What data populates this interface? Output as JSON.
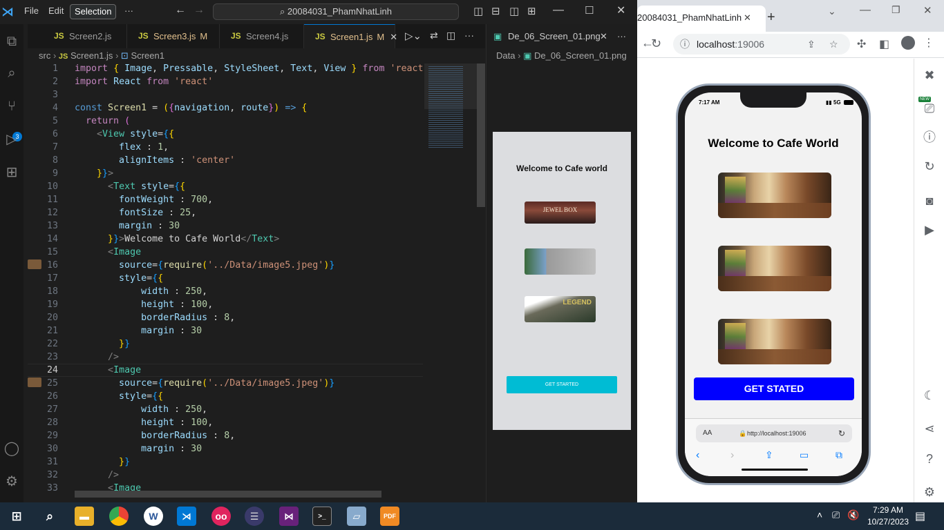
{
  "vscode": {
    "menu": [
      "File",
      "Edit",
      "Selection"
    ],
    "more": "···",
    "command_center": "20084031_PhamNhatLinh",
    "tabs": [
      {
        "label": "Screen2.js",
        "modified": ""
      },
      {
        "label": "Screen3.js",
        "modified": "M"
      },
      {
        "label": "Screen4.js",
        "modified": ""
      },
      {
        "label": "Screen1.js",
        "modified": "M"
      }
    ],
    "js_badge": "JS",
    "breadcrumb": {
      "folder": "src",
      "file": "Screen1.js",
      "symbol": "Screen1"
    },
    "scm_badge": "3",
    "line_numbers": [
      "1",
      "2",
      "3",
      "4",
      "5",
      "6",
      "7",
      "8",
      "9",
      "10",
      "11",
      "12",
      "13",
      "14",
      "15",
      "16",
      "17",
      "18",
      "19",
      "20",
      "21",
      "22",
      "23",
      "24",
      "25",
      "26",
      "27",
      "28",
      "29",
      "30",
      "31",
      "32",
      "33"
    ],
    "preview": {
      "tab_label": "De_06_Screen_01.png",
      "breadcrumb_folder": "Data",
      "breadcrumb_file": "De_06_Screen_01.png",
      "title": "Welcome to Cafe world",
      "images": [
        "JEWEL BOX",
        "",
        "LEGEND"
      ],
      "button": "GET STARTED"
    }
  },
  "chrome": {
    "tab_title": "20084031_PhamNhatLinh",
    "url_host": "localhost",
    "url_port": ":19006",
    "new_badge": "NEW",
    "phone": {
      "time": "7:17 AM",
      "network": "5G",
      "title": "Welcome to Cafe World",
      "button": "GET STATED",
      "safari_aa": "AA",
      "safari_url": "http://localhost:19006"
    }
  },
  "taskbar": {
    "time": "7:29 AM",
    "date": "10/27/2023"
  }
}
